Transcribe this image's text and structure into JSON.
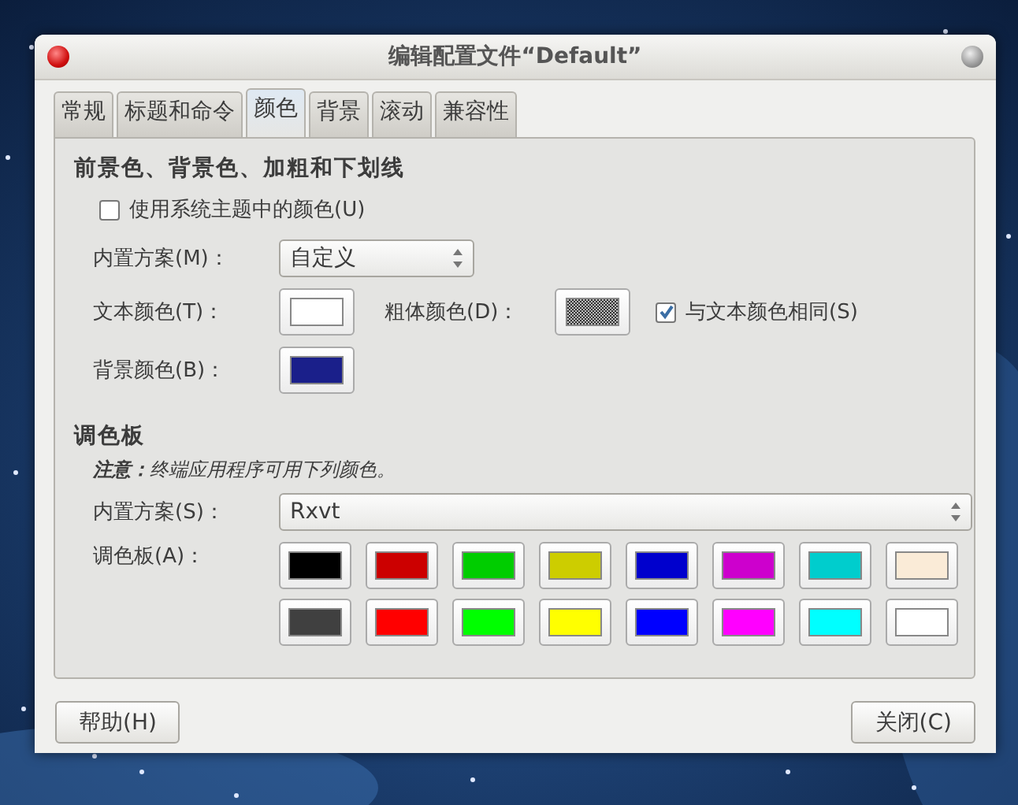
{
  "window": {
    "title": "编辑配置文件“Default”"
  },
  "tabs": [
    {
      "label": "常规",
      "selected": false
    },
    {
      "label": "标题和命令",
      "selected": false
    },
    {
      "label": "颜色",
      "selected": true
    },
    {
      "label": "背景",
      "selected": false
    },
    {
      "label": "滚动",
      "selected": false
    },
    {
      "label": "兼容性",
      "selected": false
    }
  ],
  "foreground_section": {
    "heading": "前景色、背景色、加粗和下划线",
    "use_system_colors": {
      "label": "使用系统主题中的颜色(U)",
      "checked": false
    },
    "scheme": {
      "label": "内置方案(M)：",
      "value": "自定义"
    },
    "text_color": {
      "label": "文本颜色(T)：",
      "color": "#ffffff"
    },
    "bold_color": {
      "label": "粗体颜色(D)："
    },
    "same_as_text": {
      "label": "与文本颜色相同(S)",
      "checked": true
    },
    "background_color": {
      "label": "背景颜色(B)：",
      "color": "#1a1f8a"
    }
  },
  "palette_section": {
    "heading": "调色板",
    "note": "**注意：**终端应用程序可用下列颜色。",
    "scheme": {
      "label": "内置方案(S)：",
      "value": "Rxvt"
    },
    "palette_label": "调色板(A)：",
    "colors": [
      {
        "color": "#000000"
      },
      {
        "color": "#cc0000"
      },
      {
        "color": "#00cd00"
      },
      {
        "color": "#cdcd00"
      },
      {
        "color": "#0000cd"
      },
      {
        "color": "#cd00cd"
      },
      {
        "color": "#00cdcd"
      },
      {
        "color": "#faebd7"
      },
      {
        "color": "#404040"
      },
      {
        "color": "#ff0000"
      },
      {
        "color": "#00ff00"
      },
      {
        "color": "#ffff00"
      },
      {
        "color": "#0000ff"
      },
      {
        "color": "#ff00ff"
      },
      {
        "color": "#00ffff"
      },
      {
        "color": "#ffffff"
      }
    ]
  },
  "buttons": [
    {
      "label": "帮助(H)"
    },
    {
      "label": "关闭(C)"
    }
  ]
}
